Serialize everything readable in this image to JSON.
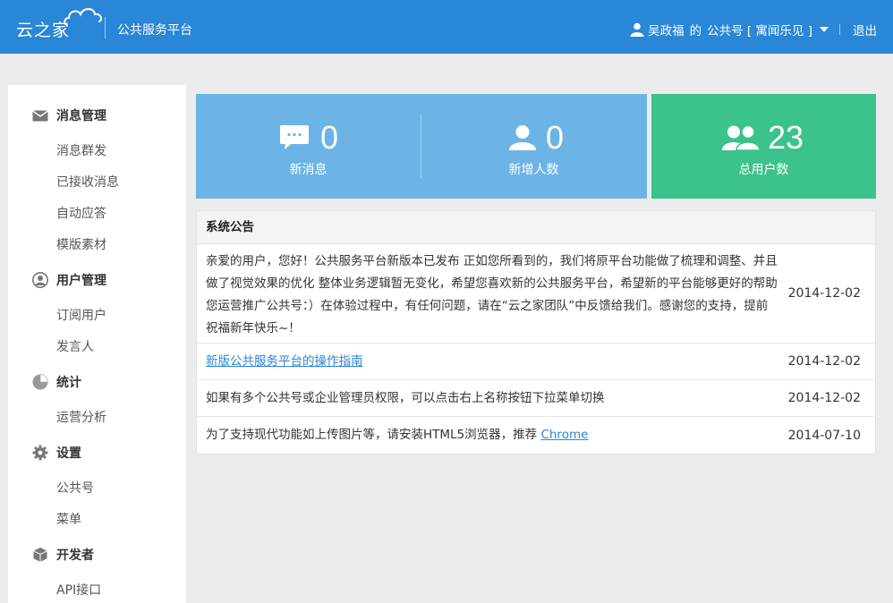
{
  "header": {
    "logo_text": "云之家",
    "platform_title": "公共服务平台",
    "user_name": "吴政福",
    "user_of": "的",
    "account_label": "公共号 [ 寓闻乐见 ]",
    "logout_label": "退出",
    "icons": [
      "cloud-icon",
      "user-icon",
      "chevron-down-icon"
    ],
    "bg_color": "#2a86d6"
  },
  "sidebar": {
    "groups": [
      {
        "title": "消息管理",
        "icon": "envelope-icon",
        "items": [
          "消息群发",
          "已接收消息",
          "自动应答",
          "模版素材"
        ]
      },
      {
        "title": "用户管理",
        "icon": "user-circle-icon",
        "items": [
          "订阅用户",
          "发言人"
        ]
      },
      {
        "title": "统计",
        "icon": "pie-chart-icon",
        "items": [
          "运营分析"
        ]
      },
      {
        "title": "设置",
        "icon": "gear-icon",
        "items": [
          "公共号",
          "菜单"
        ]
      },
      {
        "title": "开发者",
        "icon": "cube-icon",
        "items": [
          "API接口"
        ]
      }
    ]
  },
  "stats": [
    {
      "value": "0",
      "label": "新消息",
      "icon": "chat-bubble-icon",
      "color": "#6cb4e6"
    },
    {
      "value": "0",
      "label": "新增人数",
      "icon": "user-icon",
      "color": "#6cb4e6"
    },
    {
      "value": "23",
      "label": "总用户数",
      "icon": "users-icon",
      "color": "#3cc28c"
    }
  ],
  "notice": {
    "title": "系统公告",
    "rows": [
      {
        "text": "亲爱的用户，您好！公共服务平台新版本已发布 正如您所看到的，我们将原平台功能做了梳理和调整、并且做了视觉效果的优化 整体业务逻辑暂无变化，希望您喜欢新的公共服务平台，希望新的平台能够更好的帮助您运营推广公共号：）在体验过程中，有任何问题，请在“云之家团队”中反馈给我们。感谢您的支持，提前祝福新年快乐~！",
        "date": "2014-12-02"
      },
      {
        "link_text": "新版公共服务平台的操作指南",
        "date": "2014-12-02"
      },
      {
        "text": "如果有多个公共号或企业管理员权限，可以点击右上名称按钮下拉菜单切换",
        "date": "2014-12-02"
      },
      {
        "text": "为了支持现代功能如上传图片等，请安装HTML5浏览器，推荐 ",
        "link_text": "Chrome",
        "date": "2014-07-10"
      }
    ]
  }
}
